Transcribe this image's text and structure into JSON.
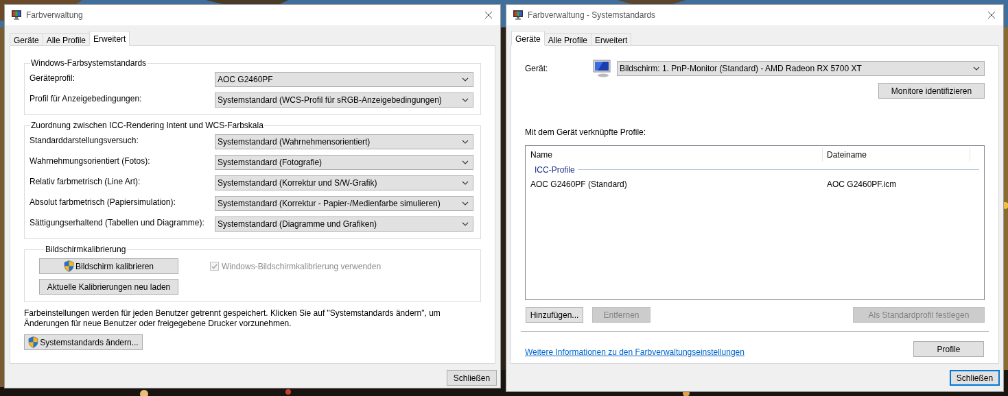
{
  "windows": [
    {
      "kind": "advanced",
      "title": "Farbverwaltung",
      "tabs": [
        {
          "label": "Geräte",
          "selected": false
        },
        {
          "label": "Alle Profile",
          "selected": false
        },
        {
          "label": "Erweitert",
          "selected": true
        }
      ],
      "groups": [
        {
          "title": "Windows-Farbsystemstandards",
          "rows": [
            {
              "label": "Geräteprofil:",
              "value": "AOC G2460PF"
            },
            {
              "label": "Profil für Anzeigebedingungen:",
              "value": "Systemstandard (WCS-Profil für sRGB-Anzeigebedingungen)"
            }
          ]
        },
        {
          "title": "Zuordnung zwischen ICC-Rendering Intent und WCS-Farbskala",
          "rows": [
            {
              "label": "Standarddarstellungsversuch:",
              "value": "Systemstandard (Wahrnehmensorientiert)"
            },
            {
              "label": "Wahrnehmungsorientiert (Fotos):",
              "value": "Systemstandard (Fotografie)"
            },
            {
              "label": "Relativ farbmetrisch (Line Art):",
              "value": "Systemstandard (Korrektur und S/W-Grafik)"
            },
            {
              "label": "Absolut farbmetrisch (Papiersimulation):",
              "value": "Systemstandard (Korrektur - Papier-/Medienfarbe simulieren)"
            },
            {
              "label": "Sättigungserhaltend (Tabellen und Diagramme):",
              "value": "Systemstandard (Diagramme und Grafiken)"
            }
          ]
        }
      ],
      "calibration": {
        "title": "Bildschirmkalibrierung",
        "buttons": [
          {
            "label": "Bildschirm kalibrieren",
            "shield": true
          },
          {
            "label": "Aktuelle Kalibrierungen neu laden",
            "shield": false
          }
        ],
        "checkbox": {
          "label": "Windows-Bildschirmkalibrierung verwenden",
          "checked": true,
          "disabled": true
        }
      },
      "note": "Farbeinstellungen werden für jeden Benutzer getrennt gespeichert. Klicken Sie auf \"Systemstandards ändern\", um Änderungen für neue Benutzer oder freigegebene Drucker vorzunehmen.",
      "change_button": {
        "label": "Systemstandards ändern...",
        "shield": true
      },
      "close_button": {
        "label": "Schließen",
        "default": false
      }
    },
    {
      "kind": "devices",
      "title": "Farbverwaltung - Systemstandards",
      "tabs": [
        {
          "label": "Geräte",
          "selected": true
        },
        {
          "label": "Alle Profile",
          "selected": false
        },
        {
          "label": "Erweitert",
          "selected": false
        }
      ],
      "device_label": "Gerät:",
      "device_value": "Bildschirm: 1. PnP-Monitor (Standard) - AMD Radeon RX 5700 XT",
      "identify_button": {
        "label": "Monitore identifizieren",
        "disabled": false
      },
      "list_label": "Mit dem Gerät verknüpfte Profile:",
      "table": {
        "columns": [
          "Name",
          "Dateiname"
        ],
        "group": "ICC-Profile",
        "rows": [
          [
            "AOC G2460PF (Standard)",
            "AOC G2460PF.icm"
          ]
        ]
      },
      "buttons": [
        {
          "label": "Hinzufügen...",
          "disabled": false
        },
        {
          "label": "Entfernen",
          "disabled": true
        },
        {
          "label": "Als Standardprofil festlegen",
          "disabled": true
        }
      ],
      "link": "Weitere Informationen zu den Farbverwaltungseinstellungen",
      "profile_button": {
        "label": "Profile",
        "disabled": false
      },
      "close_button": {
        "label": "Schließen",
        "default": true
      }
    }
  ]
}
